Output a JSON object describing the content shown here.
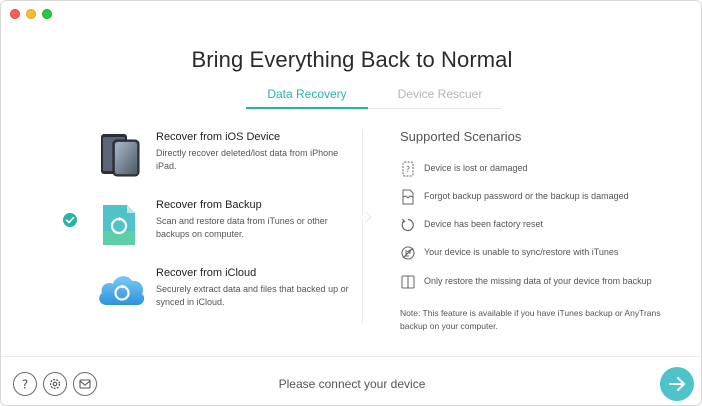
{
  "window": {
    "title": "Bring Everything Back to Normal"
  },
  "tabs": [
    {
      "label": "Data Recovery",
      "active": true
    },
    {
      "label": "Device Rescuer",
      "active": false
    }
  ],
  "options": [
    {
      "title": "Recover from iOS Device",
      "desc": "Directly recover deleted/lost data from iPhone iPad.",
      "icon": "iphone-device-icon",
      "selected": false
    },
    {
      "title": "Recover from Backup",
      "desc": "Scan and restore data from iTunes or other backups on computer.",
      "icon": "backup-document-icon",
      "selected": true
    },
    {
      "title": "Recover from iCloud",
      "desc": "Securely extract data and files that backed up or synced in iCloud.",
      "icon": "icloud-icon",
      "selected": false
    }
  ],
  "scenarios": {
    "title": "Supported Scenarios",
    "items": [
      {
        "text": "Device is lost or damaged",
        "icon": "device-question-icon"
      },
      {
        "text": "Forgot backup password or the backup is damaged",
        "icon": "broken-file-icon"
      },
      {
        "text": "Device has been factory reset",
        "icon": "reset-icon"
      },
      {
        "text": "Your device is unable to sync/restore with iTunes",
        "icon": "no-sync-icon"
      },
      {
        "text": "Only restore the missing data of your device from backup",
        "icon": "split-page-icon"
      }
    ],
    "note": "Note: This feature is available if you have iTunes backup or AnyTrans backup on your computer."
  },
  "footer": {
    "status": "Please connect your device",
    "buttons": [
      "help-icon",
      "settings-icon",
      "mail-icon"
    ]
  },
  "colors": {
    "accent": "#2ab3a6",
    "go_button": "#4fc3c9"
  }
}
